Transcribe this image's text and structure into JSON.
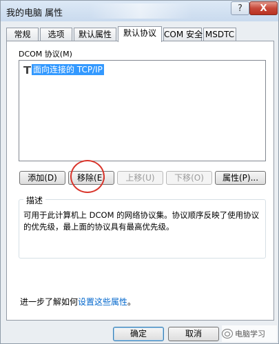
{
  "window": {
    "title": "我的电脑 属性",
    "help_label": "?",
    "close_label": "X"
  },
  "tabs": [
    {
      "label": "常规",
      "active": false
    },
    {
      "label": "选项",
      "active": false
    },
    {
      "label": "默认属性",
      "active": false
    },
    {
      "label": "默认协议",
      "active": true
    },
    {
      "label": "COM 安全",
      "active": false
    },
    {
      "label": "MSDTC",
      "active": false
    }
  ],
  "protocols": {
    "label": "DCOM 协议(M)",
    "items": [
      {
        "name": "面向连接的 TCP/IP",
        "selected": true,
        "icon": "network-protocol-icon"
      }
    ]
  },
  "buttons": {
    "add": "添加(D)",
    "remove": "移除(E)",
    "move_up": "上移(U)",
    "move_down": "下移(O)",
    "properties": "属性(P)..."
  },
  "description": {
    "legend": "描述",
    "text": "可用于此计算机上 DCOM 的网络协议集。协议顺序反映了使用协议的优先级，最上面的协议具有最高优先级。"
  },
  "footer": {
    "prefix": "进一步了解如何",
    "link": "设置这些属性",
    "suffix": "。"
  },
  "dialog_buttons": {
    "ok": "确定",
    "cancel": "取消"
  },
  "watermark": {
    "text": "电脑学习"
  },
  "colors": {
    "selection": "#3399ff",
    "annotation_circle": "#d9352b",
    "link": "#0066cc",
    "close_button": "#c7493a"
  }
}
